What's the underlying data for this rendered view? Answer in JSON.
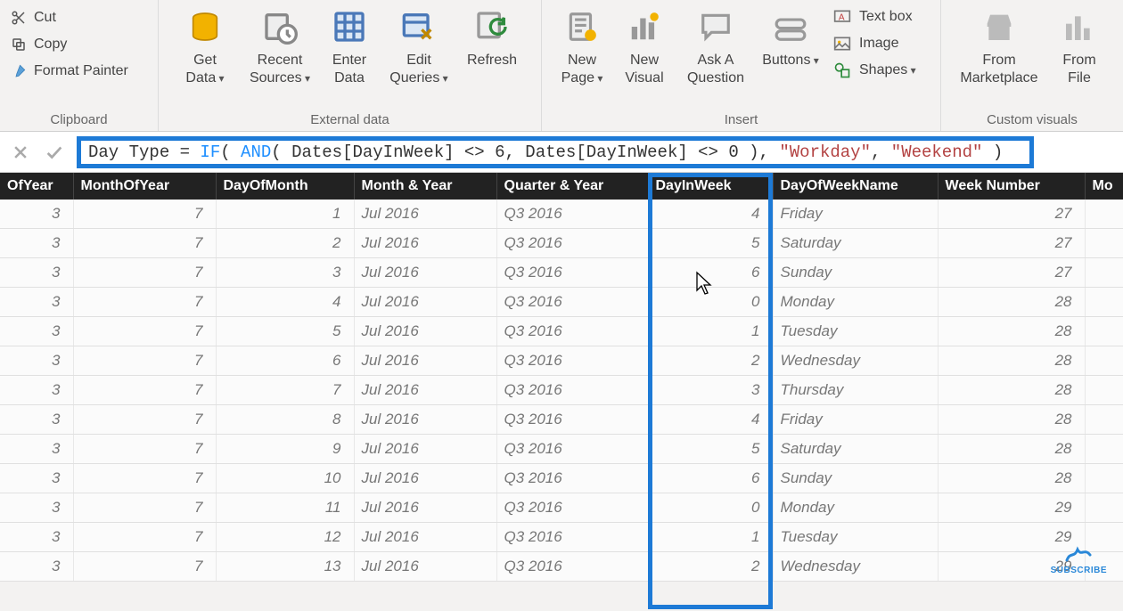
{
  "ribbon": {
    "clipboard": {
      "label": "Clipboard",
      "cut": "Cut",
      "copy": "Copy",
      "format_painter": "Format Painter"
    },
    "external_data": {
      "label": "External data",
      "get_data": "Get\nData",
      "recent_sources": "Recent\nSources",
      "enter_data": "Enter\nData",
      "edit_queries": "Edit\nQueries",
      "refresh": "Refresh"
    },
    "insert": {
      "label": "Insert",
      "new_page": "New\nPage",
      "new_visual": "New\nVisual",
      "ask_question": "Ask A\nQuestion",
      "buttons": "Buttons",
      "text_box": "Text box",
      "image": "Image",
      "shapes": "Shapes"
    },
    "custom_visuals": {
      "label": "Custom visuals",
      "from_marketplace": "From\nMarketplace",
      "from_file": "From\nFile"
    }
  },
  "formula": {
    "prefix": "Day Type = ",
    "fn_if": "IF",
    "paren_open": "( ",
    "fn_and": "AND",
    "args_mid": "( Dates[DayInWeek] <> 6, Dates[DayInWeek] <> 0 ), ",
    "str_workday": "\"Workday\"",
    "comma": ", ",
    "str_weekend": "\"Weekend\"",
    "paren_close": " )"
  },
  "table": {
    "columns": [
      "OfYear",
      "MonthOfYear",
      "DayOfMonth",
      "Month & Year",
      "Quarter & Year",
      "DayInWeek",
      "DayOfWeekName",
      "Week Number",
      "Mo"
    ],
    "rows": [
      {
        "ofYear": 3,
        "monthOfYear": 7,
        "dayOfMonth": 1,
        "monthYear": "Jul 2016",
        "quarterYear": "Q3 2016",
        "dayInWeek": 4,
        "dowName": "Friday",
        "weekNum": 27
      },
      {
        "ofYear": 3,
        "monthOfYear": 7,
        "dayOfMonth": 2,
        "monthYear": "Jul 2016",
        "quarterYear": "Q3 2016",
        "dayInWeek": 5,
        "dowName": "Saturday",
        "weekNum": 27
      },
      {
        "ofYear": 3,
        "monthOfYear": 7,
        "dayOfMonth": 3,
        "monthYear": "Jul 2016",
        "quarterYear": "Q3 2016",
        "dayInWeek": 6,
        "dowName": "Sunday",
        "weekNum": 27
      },
      {
        "ofYear": 3,
        "monthOfYear": 7,
        "dayOfMonth": 4,
        "monthYear": "Jul 2016",
        "quarterYear": "Q3 2016",
        "dayInWeek": 0,
        "dowName": "Monday",
        "weekNum": 28
      },
      {
        "ofYear": 3,
        "monthOfYear": 7,
        "dayOfMonth": 5,
        "monthYear": "Jul 2016",
        "quarterYear": "Q3 2016",
        "dayInWeek": 1,
        "dowName": "Tuesday",
        "weekNum": 28
      },
      {
        "ofYear": 3,
        "monthOfYear": 7,
        "dayOfMonth": 6,
        "monthYear": "Jul 2016",
        "quarterYear": "Q3 2016",
        "dayInWeek": 2,
        "dowName": "Wednesday",
        "weekNum": 28
      },
      {
        "ofYear": 3,
        "monthOfYear": 7,
        "dayOfMonth": 7,
        "monthYear": "Jul 2016",
        "quarterYear": "Q3 2016",
        "dayInWeek": 3,
        "dowName": "Thursday",
        "weekNum": 28
      },
      {
        "ofYear": 3,
        "monthOfYear": 7,
        "dayOfMonth": 8,
        "monthYear": "Jul 2016",
        "quarterYear": "Q3 2016",
        "dayInWeek": 4,
        "dowName": "Friday",
        "weekNum": 28
      },
      {
        "ofYear": 3,
        "monthOfYear": 7,
        "dayOfMonth": 9,
        "monthYear": "Jul 2016",
        "quarterYear": "Q3 2016",
        "dayInWeek": 5,
        "dowName": "Saturday",
        "weekNum": 28
      },
      {
        "ofYear": 3,
        "monthOfYear": 7,
        "dayOfMonth": 10,
        "monthYear": "Jul 2016",
        "quarterYear": "Q3 2016",
        "dayInWeek": 6,
        "dowName": "Sunday",
        "weekNum": 28
      },
      {
        "ofYear": 3,
        "monthOfYear": 7,
        "dayOfMonth": 11,
        "monthYear": "Jul 2016",
        "quarterYear": "Q3 2016",
        "dayInWeek": 0,
        "dowName": "Monday",
        "weekNum": 29
      },
      {
        "ofYear": 3,
        "monthOfYear": 7,
        "dayOfMonth": 12,
        "monthYear": "Jul 2016",
        "quarterYear": "Q3 2016",
        "dayInWeek": 1,
        "dowName": "Tuesday",
        "weekNum": 29
      },
      {
        "ofYear": 3,
        "monthOfYear": 7,
        "dayOfMonth": 13,
        "monthYear": "Jul 2016",
        "quarterYear": "Q3 2016",
        "dayInWeek": 2,
        "dowName": "Wednesday",
        "weekNum": 29
      }
    ]
  },
  "subscribe": "SUBSCRIBE"
}
